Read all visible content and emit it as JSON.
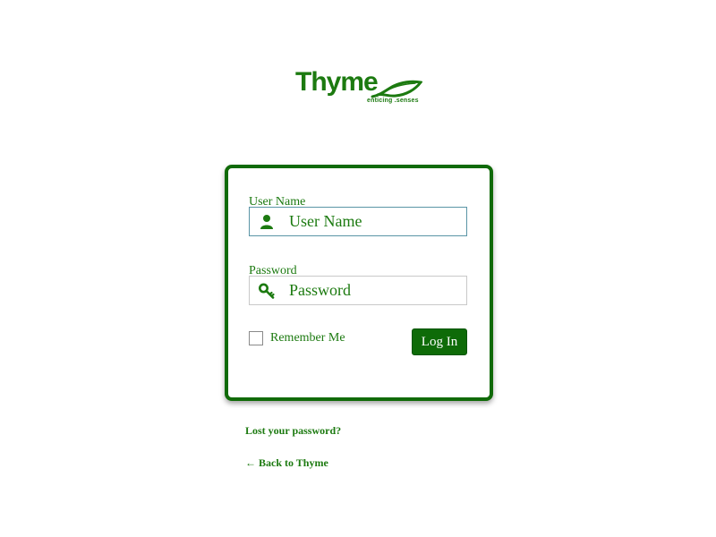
{
  "brand": {
    "name": "Thyme",
    "tagline": "enticing .senses",
    "color": "#1c7a10"
  },
  "login_form": {
    "username": {
      "label": "User Name",
      "placeholder": "User Name",
      "value": "",
      "icon": "user-icon"
    },
    "password": {
      "label": "Password",
      "placeholder": "Password",
      "value": "",
      "icon": "key-icon"
    },
    "remember_me": {
      "label": "Remember Me",
      "checked": false
    },
    "submit_label": "Log In",
    "button_color": "#0e6b08"
  },
  "links": {
    "lost_password": "Lost your password?",
    "back_to_site": "← Back to Thyme"
  }
}
